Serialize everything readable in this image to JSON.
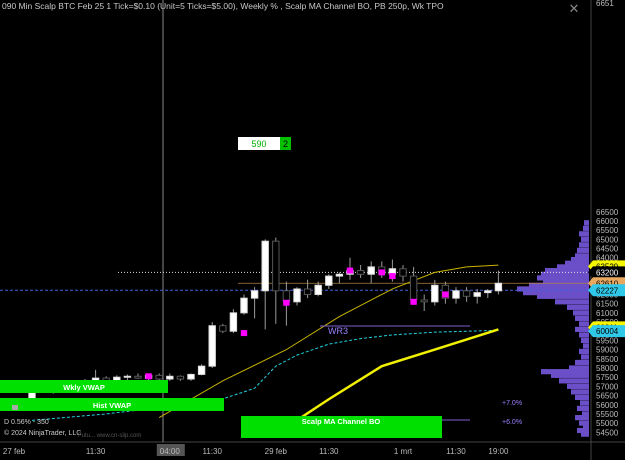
{
  "header": {
    "title": "090 Min Scalp BTC Feb 25 1 Tick=$0.10 (Unit=5 Ticks=$5.00), Weekly % , Scalp MA Channel BO, PB 250p, Wk TPO"
  },
  "close_icon": "close-icon",
  "footer": {
    "copyright": "© 2024 NinjaTrader, LLC",
    "stats": "D 0.56% - 350",
    "url": "Futu... www.cn-slip.com"
  },
  "labels": {
    "weekly_vwap": "Wkly VWAP",
    "hist_vwap": "Hist VWAP",
    "scalp_ma": "Scalp MA Channel BO",
    "wr3": "WR3",
    "pct_7": "+7.0%",
    "pct_6": "+6.0%",
    "box_value": "590",
    "box_count": "2"
  },
  "colors": {
    "background": "#000000",
    "bull": "#ffffff",
    "bear": "#555555",
    "wick": "#9a9a9a",
    "magenta": "#ff00ff",
    "green": "#00e000",
    "yellow_thick": "#f0f000",
    "yellow_thin": "#c8b400",
    "cyan": "#22d3e0",
    "profile": "#6a4fc8",
    "price_tag_yellow": "#f5f500",
    "price_tag_orange": "#e8a860",
    "price_tag_cyan": "#30c8e8"
  },
  "chart_data": {
    "type": "candlestick",
    "title": "090 Min Scalp BTC Feb 25 1 Tick=$0.10 (Unit=5 Ticks=$5.00), Weekly % , Scalp MA Channel BO, PB 250p, Wk TPO",
    "ylim": [
      54300,
      66700
    ],
    "y_ticks": [
      54500,
      55000,
      55500,
      56000,
      56500,
      57000,
      57500,
      58000,
      58500,
      59000,
      59500,
      60000,
      60500,
      61000,
      61500,
      62000,
      62500,
      63000,
      63500,
      64000,
      64500,
      65000,
      65500,
      66000,
      66500
    ],
    "x_ticks": [
      {
        "label": "27 feb",
        "i": 0
      },
      {
        "label": "11:30",
        "i": 6
      },
      {
        "label": "04:00",
        "i": 13
      },
      {
        "label": "11:30",
        "i": 17
      },
      {
        "label": "29 feb",
        "i": 23
      },
      {
        "label": "11:30",
        "i": 28
      },
      {
        "label": "1 mrt",
        "i": 35
      },
      {
        "label": "11:30",
        "i": 40
      },
      {
        "label": "19:00",
        "i": 44
      }
    ],
    "candles": [
      {
        "o": 56100,
        "h": 57300,
        "l": 55900,
        "c": 57000
      },
      {
        "o": 57000,
        "h": 57200,
        "l": 56700,
        "c": 56800
      },
      {
        "o": 56800,
        "h": 57000,
        "l": 56600,
        "c": 56850
      },
      {
        "o": 56850,
        "h": 57000,
        "l": 56700,
        "c": 56750
      },
      {
        "o": 56750,
        "h": 57100,
        "l": 56700,
        "c": 57050
      },
      {
        "o": 57050,
        "h": 57400,
        "l": 56900,
        "c": 57200
      },
      {
        "o": 57200,
        "h": 57900,
        "l": 57100,
        "c": 57450
      },
      {
        "o": 57450,
        "h": 57550,
        "l": 57250,
        "c": 57300
      },
      {
        "o": 57300,
        "h": 57600,
        "l": 57200,
        "c": 57500
      },
      {
        "o": 57500,
        "h": 57650,
        "l": 57300,
        "c": 57550
      },
      {
        "o": 57550,
        "h": 57700,
        "l": 57400,
        "c": 57450
      },
      {
        "o": 57450,
        "h": 57700,
        "l": 57300,
        "c": 57600
      },
      {
        "o": 57600,
        "h": 57700,
        "l": 57300,
        "c": 57400
      },
      {
        "o": 57400,
        "h": 57700,
        "l": 57300,
        "c": 57550
      },
      {
        "o": 57550,
        "h": 57600,
        "l": 57300,
        "c": 57400
      },
      {
        "o": 57400,
        "h": 57700,
        "l": 57300,
        "c": 57650
      },
      {
        "o": 57650,
        "h": 58200,
        "l": 57600,
        "c": 58100
      },
      {
        "o": 58100,
        "h": 60500,
        "l": 58000,
        "c": 60300
      },
      {
        "o": 60300,
        "h": 60400,
        "l": 59900,
        "c": 60000
      },
      {
        "o": 60000,
        "h": 61200,
        "l": 59900,
        "c": 61000
      },
      {
        "o": 61000,
        "h": 62000,
        "l": 60900,
        "c": 61800
      },
      {
        "o": 61800,
        "h": 62400,
        "l": 60700,
        "c": 62200
      },
      {
        "o": 62200,
        "h": 65000,
        "l": 60100,
        "c": 64900
      },
      {
        "o": 64900,
        "h": 65100,
        "l": 60400,
        "c": 62200
      },
      {
        "o": 62200,
        "h": 62700,
        "l": 60300,
        "c": 61600
      },
      {
        "o": 61600,
        "h": 62400,
        "l": 61400,
        "c": 62300
      },
      {
        "o": 62300,
        "h": 62800,
        "l": 61800,
        "c": 62000
      },
      {
        "o": 62000,
        "h": 62700,
        "l": 61900,
        "c": 62500
      },
      {
        "o": 62500,
        "h": 63100,
        "l": 62300,
        "c": 63000
      },
      {
        "o": 63000,
        "h": 63200,
        "l": 62600,
        "c": 63100
      },
      {
        "o": 63100,
        "h": 64000,
        "l": 62800,
        "c": 63300
      },
      {
        "o": 63300,
        "h": 63600,
        "l": 62900,
        "c": 63100
      },
      {
        "o": 63100,
        "h": 63800,
        "l": 62600,
        "c": 63500
      },
      {
        "o": 63500,
        "h": 63800,
        "l": 62900,
        "c": 63100
      },
      {
        "o": 63100,
        "h": 63900,
        "l": 62700,
        "c": 63400
      },
      {
        "o": 63400,
        "h": 63600,
        "l": 62700,
        "c": 63000
      },
      {
        "o": 63000,
        "h": 63500,
        "l": 61500,
        "c": 61700
      },
      {
        "o": 61700,
        "h": 62000,
        "l": 61100,
        "c": 61600
      },
      {
        "o": 61600,
        "h": 62800,
        "l": 61400,
        "c": 62500
      },
      {
        "o": 62500,
        "h": 62700,
        "l": 61500,
        "c": 61800
      },
      {
        "o": 61800,
        "h": 62400,
        "l": 61500,
        "c": 62200
      },
      {
        "o": 62200,
        "h": 62400,
        "l": 61600,
        "c": 61900
      },
      {
        "o": 61900,
        "h": 62300,
        "l": 61500,
        "c": 62100
      },
      {
        "o": 62100,
        "h": 62300,
        "l": 61800,
        "c": 62200
      },
      {
        "o": 62200,
        "h": 63300,
        "l": 62000,
        "c": 62610
      }
    ],
    "magenta_marks": [
      {
        "i": 5,
        "y": 57150
      },
      {
        "i": 11,
        "y": 57550
      },
      {
        "i": 20,
        "y": 59900
      },
      {
        "i": 24,
        "y": 61550
      },
      {
        "i": 30,
        "y": 63300
      },
      {
        "i": 33,
        "y": 63200
      },
      {
        "i": 34,
        "y": 63000
      },
      {
        "i": 36,
        "y": 61600
      },
      {
        "i": 39,
        "y": 62000
      }
    ],
    "price_tags": [
      {
        "value": "63529",
        "y": 63529,
        "style": "yellow"
      },
      {
        "value": "63200",
        "y": 63200,
        "style": "plain"
      },
      {
        "value": "62610",
        "y": 62610,
        "style": "orange"
      },
      {
        "value": "62227",
        "y": 62227,
        "style": "cyan"
      },
      {
        "value": "60211",
        "y": 60211,
        "style": "yellow"
      },
      {
        "value": "60004",
        "y": 60004,
        "style": "cyan"
      }
    ],
    "top_tick_label": "6651",
    "ma_thick": [
      [
        23,
        54400
      ],
      [
        28,
        56300
      ],
      [
        33,
        58100
      ],
      [
        38,
        59000
      ],
      [
        44,
        60100
      ]
    ],
    "ma_thin": [
      [
        12,
        55300
      ],
      [
        18,
        57300
      ],
      [
        24,
        59000
      ],
      [
        29,
        60800
      ],
      [
        34,
        62300
      ],
      [
        38,
        63200
      ],
      [
        41,
        63500
      ],
      [
        44,
        63600
      ]
    ],
    "cyan_line": [
      [
        0,
        55150
      ],
      [
        7,
        55500
      ],
      [
        12,
        55850
      ],
      [
        16,
        55950
      ],
      [
        20,
        56700
      ],
      [
        21,
        56900
      ],
      [
        23,
        58100
      ],
      [
        25,
        58700
      ],
      [
        28,
        59300
      ],
      [
        31,
        59600
      ],
      [
        34,
        59800
      ],
      [
        38,
        59950
      ],
      [
        44,
        60050
      ]
    ],
    "tpo_profile": [
      [
        54400,
        8
      ],
      [
        54600,
        12
      ],
      [
        54800,
        6
      ],
      [
        55000,
        10
      ],
      [
        55300,
        14
      ],
      [
        55500,
        7
      ],
      [
        55800,
        12
      ],
      [
        56100,
        9
      ],
      [
        56400,
        14
      ],
      [
        56700,
        18
      ],
      [
        57000,
        22
      ],
      [
        57300,
        30
      ],
      [
        57600,
        38
      ],
      [
        57800,
        48
      ],
      [
        58000,
        20
      ],
      [
        58300,
        14
      ],
      [
        58600,
        8
      ],
      [
        58900,
        10
      ],
      [
        59200,
        6
      ],
      [
        59500,
        8
      ],
      [
        59800,
        10
      ],
      [
        60100,
        14
      ],
      [
        60400,
        10
      ],
      [
        60700,
        14
      ],
      [
        61000,
        16
      ],
      [
        61300,
        22
      ],
      [
        61600,
        34
      ],
      [
        61900,
        52
      ],
      [
        62100,
        66
      ],
      [
        62300,
        72
      ],
      [
        62500,
        60
      ],
      [
        62700,
        46
      ],
      [
        62900,
        52
      ],
      [
        63100,
        48
      ],
      [
        63300,
        44
      ],
      [
        63500,
        32
      ],
      [
        63700,
        24
      ],
      [
        63900,
        18
      ],
      [
        64100,
        14
      ],
      [
        64400,
        12
      ],
      [
        64700,
        10
      ],
      [
        65000,
        8
      ],
      [
        65300,
        10
      ],
      [
        65600,
        6
      ],
      [
        65900,
        5
      ]
    ]
  }
}
